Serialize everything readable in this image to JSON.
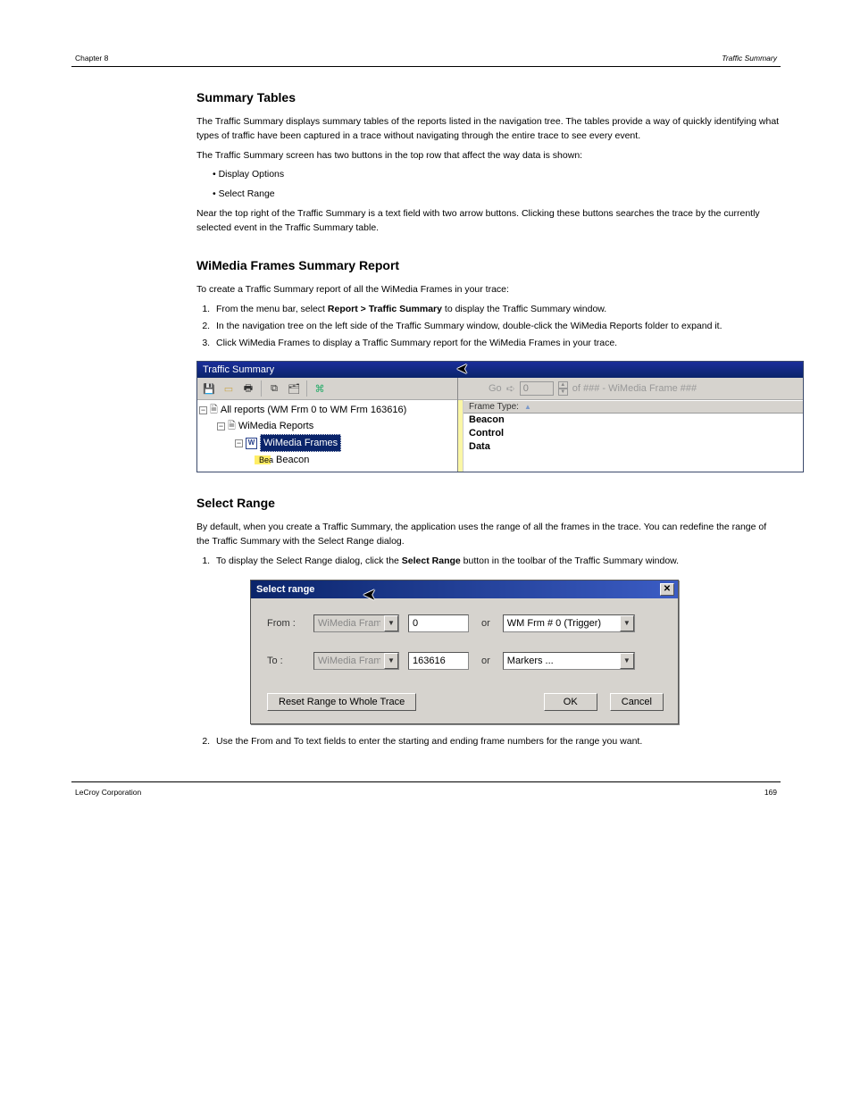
{
  "header": {
    "chapter": "Chapter 8",
    "title": "Traffic Summary"
  },
  "footer": {
    "left": "LeCroy Corporation",
    "right": "169"
  },
  "section1_title": "Summary Tables",
  "p1": "The Traffic Summary displays summary tables of the reports listed in the navigation tree. The tables provide a way of quickly identifying what types of traffic have been captured in a trace without navigating through the entire trace to see every event.",
  "p2": "The Traffic Summary screen has two buttons in the top row that affect the way data is shown:",
  "bullet1": "Display Options",
  "bullet2": "Select Range",
  "p3": "Near the top right of the Traffic Summary is a text field with two arrow buttons. Clicking these buttons searches the trace by the currently selected event in the Traffic Summary table.",
  "section2_title": "WiMedia Frames Summary Report",
  "p4": "To create a Traffic Summary report of all the WiMedia Frames in your trace:",
  "step1_a": "From the menu bar, select ",
  "step1_b": "Report > Traffic Summary",
  "step1_c": " to display the Traffic Summary window.",
  "step2": "In the navigation tree on the left side of the Traffic Summary window, double-click the WiMedia Reports folder to expand it.",
  "step3": "Click WiMedia Frames to display a Traffic Summary report for the WiMedia Frames in your trace.",
  "section3_title": "Select Range",
  "p5": "By default, when you create a Traffic Summary, the application uses the range of all the frames in the trace. You can redefine the range of the Traffic Summary with the Select Range dialog.",
  "dlg_step1_a": "To display the Select Range dialog, click the ",
  "dlg_step1_b": "Select Range",
  "dlg_step1_c": " button in the toolbar of the Traffic Summary window.",
  "ts": {
    "title": "Traffic Summary",
    "go": "Go",
    "go_value": "0",
    "of_text": "of ### - WiMedia Frame ###",
    "root": "All reports (WM Frm 0 to WM Frm 163616)",
    "wimedia_reports": "WiMedia Reports",
    "wimedia_frames": "WiMedia Frames",
    "beacon_pref": "Bea",
    "beacon": "Beacon",
    "col_header": "Frame Type:",
    "rows": {
      "r0": "Beacon",
      "r1": "Control",
      "r2": "Data"
    }
  },
  "sr": {
    "title": "Select range",
    "from_label": "From :",
    "to_label": "To :",
    "unit": "WiMedia Fram",
    "from_value": "0",
    "to_value": "163616",
    "or": "or",
    "from_marker": "WM Frm # 0 (Trigger)",
    "to_marker": "Markers ...",
    "reset": "Reset Range to Whole Trace",
    "ok": "OK",
    "cancel": "Cancel"
  },
  "dlg_step2": "Use the From and To text fields to enter the starting and ending frame numbers for the range you want."
}
